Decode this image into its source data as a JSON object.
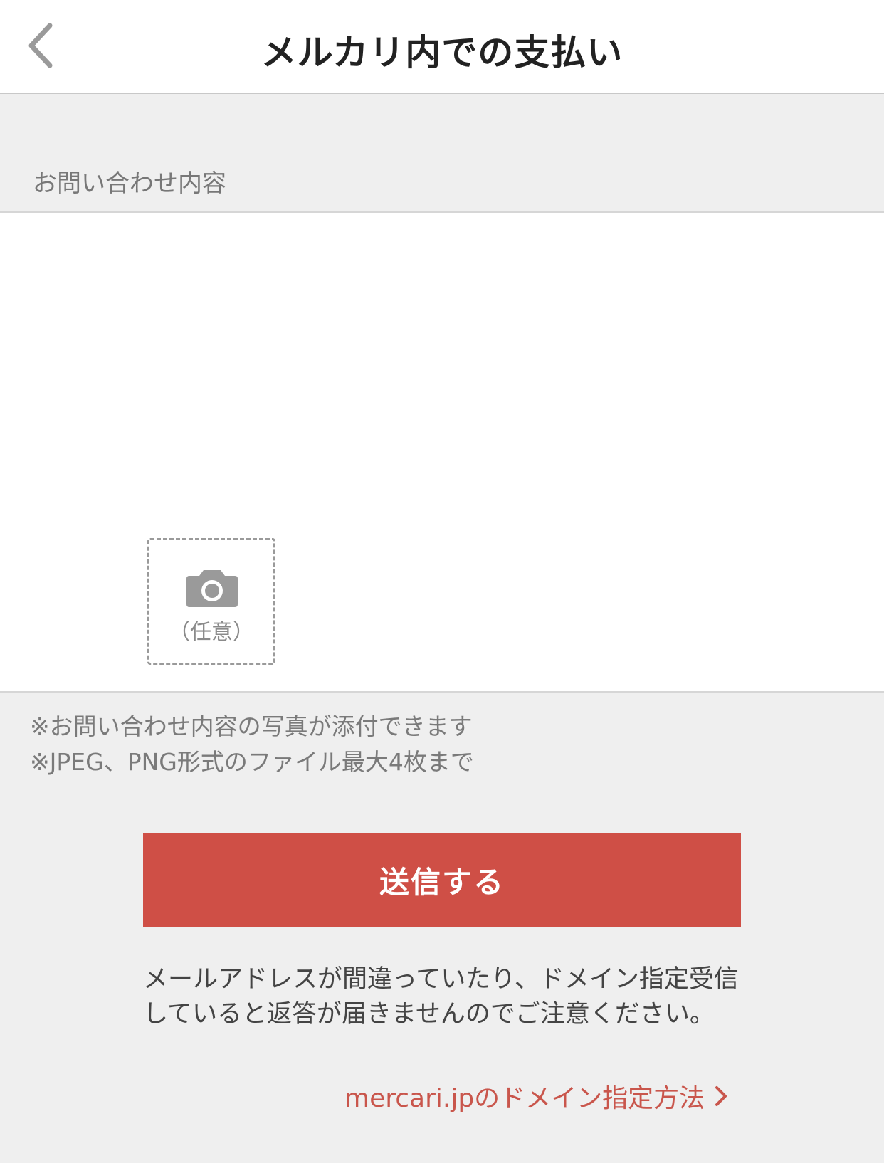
{
  "header": {
    "title": "メルカリ内での支払い"
  },
  "form": {
    "section_label": "お問い合わせ内容",
    "content_value": "",
    "photo_label": "（任意）"
  },
  "notes": [
    "※お問い合わせ内容の写真が添付できます",
    "※JPEG、PNG形式のファイル最大4枚まで"
  ],
  "submit_label": "送信する",
  "warning": "メールアドレスが間違っていたり、ドメイン指定受信していると返答が届きませんのでご注意ください。",
  "domain_link": "mercari.jpのドメイン指定方法",
  "colors": {
    "accent": "#cf4f46",
    "link": "#c9564c",
    "background": "#efefef"
  },
  "icons": [
    "chevron-left-icon",
    "camera-icon",
    "chevron-right-icon"
  ]
}
